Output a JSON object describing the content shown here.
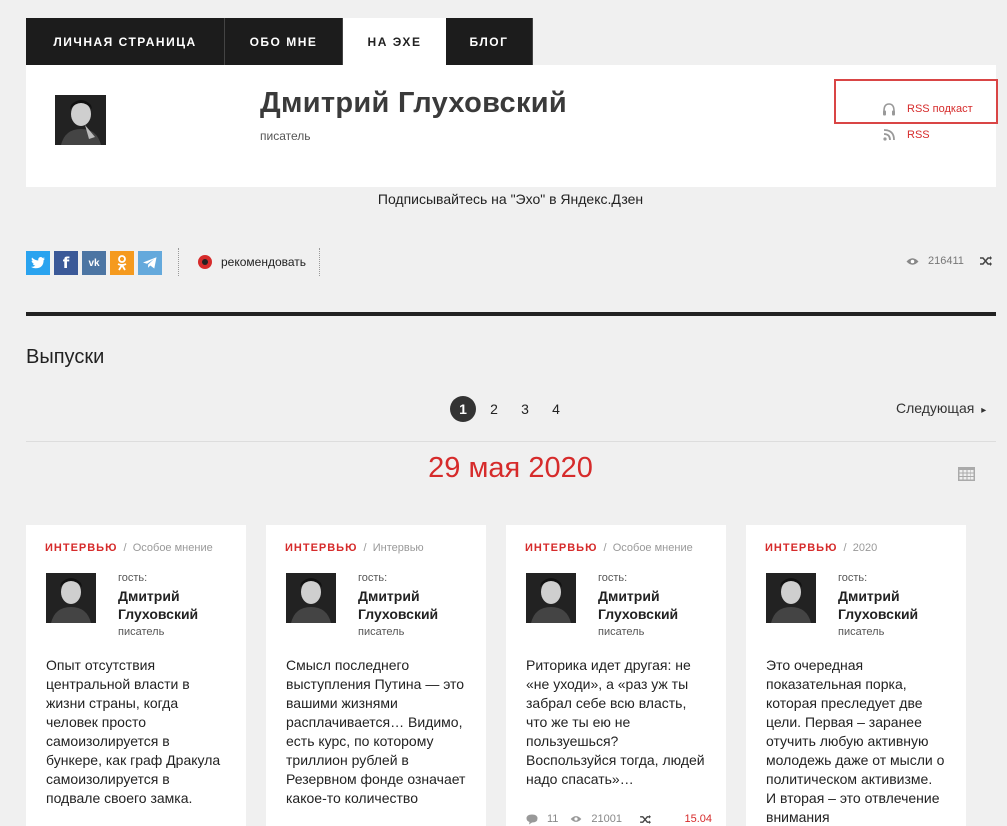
{
  "tabs": [
    {
      "label": "ЛИЧНАЯ СТРАНИЦА"
    },
    {
      "label": "ОБО МНЕ"
    },
    {
      "label": "НА ЭХЕ"
    },
    {
      "label": "БЛОГ"
    }
  ],
  "author": {
    "name": "Дмитрий Глуховский",
    "role": "писатель"
  },
  "rss": {
    "podcast_label": "RSS подкаст",
    "rss_label": "RSS"
  },
  "subscribe_text": "Подписывайтесь на \"Эхо\" в Яндекс.Дзен",
  "share": {
    "buttons": [
      {
        "name": "twitter",
        "color": "#2aa3ef"
      },
      {
        "name": "facebook",
        "color": "#3b5998"
      },
      {
        "name": "vkontakte",
        "color": "#4c75a3"
      },
      {
        "name": "odnoklassniki",
        "color": "#f59a1e"
      },
      {
        "name": "telegram",
        "color": "#64a9dc"
      }
    ],
    "recommend_label": "рекомендовать",
    "views": "216411"
  },
  "section_title": "Выпуски",
  "pagination": {
    "pages": [
      "1",
      "2",
      "3",
      "4"
    ],
    "active": "1",
    "next_label": "Следующая"
  },
  "date_heading": "29 мая 2020",
  "cards": [
    {
      "category": "ИНТЕРВЬЮ",
      "program": "Особое мнение",
      "guest_label": "гость:",
      "guest_name": "Дмитрий Глуховский",
      "guest_role": "писатель",
      "text": "Опыт отсутствия центральной власти в жизни страны, когда человек просто самоизолируется в бункере, как граф Дракула самоизолируется в подвале своего замка."
    },
    {
      "category": "ИНТЕРВЬЮ",
      "program": "Интервью",
      "guest_label": "гость:",
      "guest_name": "Дмитрий Глуховский",
      "guest_role": "писатель",
      "text": "Смысл последнего выступления Путина — это вашими жизнями расплачивается… Видимо, есть курс, по которому триллион рублей в Резервном фонде означает какое-то количество"
    },
    {
      "category": "ИНТЕРВЬЮ",
      "program": "Особое мнение",
      "guest_label": "гость:",
      "guest_name": "Дмитрий Глуховский",
      "guest_role": "писатель",
      "text": "Риторика идет другая: не «не уходи», а «раз уж ты забрал себе всю власть, что же ты ею не пользуешься? Воспользуйся тогда, людей надо спасать»…",
      "comments": "11",
      "views": "21001",
      "time": "15.04"
    },
    {
      "category": "ИНТЕРВЬЮ",
      "program": "2020",
      "guest_label": "гость:",
      "guest_name": "Дмитрий Глуховский",
      "guest_role": "писатель",
      "text": "Это очередная показательная порка, которая преследует две цели. Первая – заранее отучить любую активную молодежь даже от мысли о политическом активизме. И вторая – это отвлечение внимания"
    }
  ],
  "colors": {
    "accent": "#d62b2b",
    "dark": "#1c1c1c",
    "background": "#f0f0f0"
  }
}
